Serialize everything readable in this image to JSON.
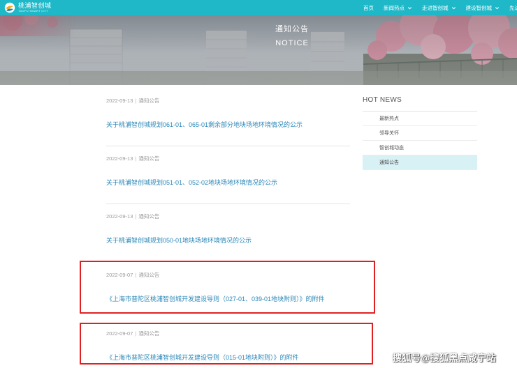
{
  "header": {
    "logo_cn": "桃浦智创城",
    "logo_en": "TAOPU SMART CITY",
    "nav": [
      {
        "label": "首页",
        "dropdown": false
      },
      {
        "label": "新闻热点",
        "dropdown": true
      },
      {
        "label": "走进智创城",
        "dropdown": true
      },
      {
        "label": "建设智创城",
        "dropdown": true
      },
      {
        "label": "先进",
        "dropdown": false
      }
    ]
  },
  "banner": {
    "title_cn": "通知公告",
    "title_en": "NOTICE"
  },
  "notices": [
    {
      "date": "2022-09-13",
      "separator": "|",
      "category": "通知公告",
      "title": "关于桃浦智创城规划061-01、065-01剩余部分地块场地环境情况的公示"
    },
    {
      "date": "2022-09-13",
      "separator": "|",
      "category": "通知公告",
      "title": "关于桃浦智创城规划051-01、052-02地块场地环境情况的公示"
    },
    {
      "date": "2022-09-13",
      "separator": "|",
      "category": "通知公告",
      "title": "关于桃浦智创城规划050-01地块场地环境情况的公示"
    },
    {
      "date": "2022-09-07",
      "separator": "|",
      "category": "通知公告",
      "title": "《上海市普陀区桃浦智创城开发建设导则（027-01、039-01地块附则）》的附件"
    },
    {
      "date": "2022-09-07",
      "separator": "|",
      "category": "通知公告",
      "title": "《上海市普陀区桃浦智创城开发建设导则（015-01地块附则）》的附件"
    }
  ],
  "sidebar": {
    "title": "HOT NEWS",
    "items": [
      {
        "label": "最新热点",
        "active": false
      },
      {
        "label": "领导关怀",
        "active": false
      },
      {
        "label": "智创城动态",
        "active": false
      },
      {
        "label": "通知公告",
        "active": true
      }
    ]
  },
  "watermark": "搜狐号@搜狐黑点咸宁站",
  "colors": {
    "nav_bg": "#1fb8c8",
    "link": "#2a87b8",
    "highlight_box": "#e02020",
    "active_sidebar_bg": "#d8f1f5"
  },
  "icons": {
    "nav_dropdown": "chevron-down-icon",
    "logo": "logo-icon"
  }
}
